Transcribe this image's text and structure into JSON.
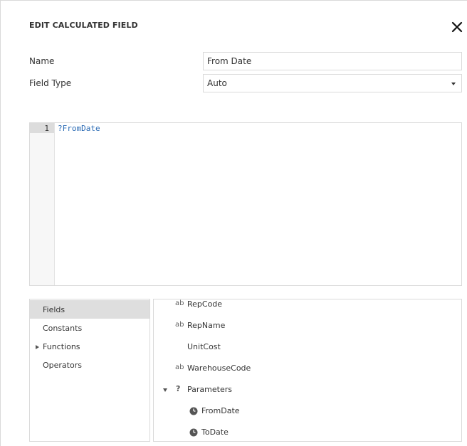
{
  "dialog": {
    "title": "EDIT CALCULATED FIELD",
    "close_icon": "close-icon"
  },
  "form": {
    "name_label": "Name",
    "name_value": "From Date",
    "field_type_label": "Field Type",
    "field_type_value": "Auto"
  },
  "editor": {
    "line_number": "1",
    "code": "?FromDate"
  },
  "categories": {
    "items": [
      {
        "label": "Fields",
        "selected": true
      },
      {
        "label": "Constants",
        "selected": false
      },
      {
        "label": "Functions",
        "selected": false,
        "expandable": true
      },
      {
        "label": "Operators",
        "selected": false
      }
    ]
  },
  "tree": {
    "items": [
      {
        "label": "RepCode",
        "icon": "string-icon"
      },
      {
        "label": "RepName",
        "icon": "string-icon"
      },
      {
        "label": "UnitCost",
        "icon": "none"
      },
      {
        "label": "WarehouseCode",
        "icon": "string-icon"
      },
      {
        "label": "Parameters",
        "icon": "parameter-icon",
        "expanded": true
      },
      {
        "label": "FromDate",
        "icon": "clock-icon"
      },
      {
        "label": "ToDate",
        "icon": "clock-icon"
      }
    ],
    "string_glyph": "ab",
    "parameter_glyph": "?"
  },
  "colors": {
    "code_text": "#2a6ab4",
    "selected_bg": "#dedede",
    "border": "#dadada"
  }
}
